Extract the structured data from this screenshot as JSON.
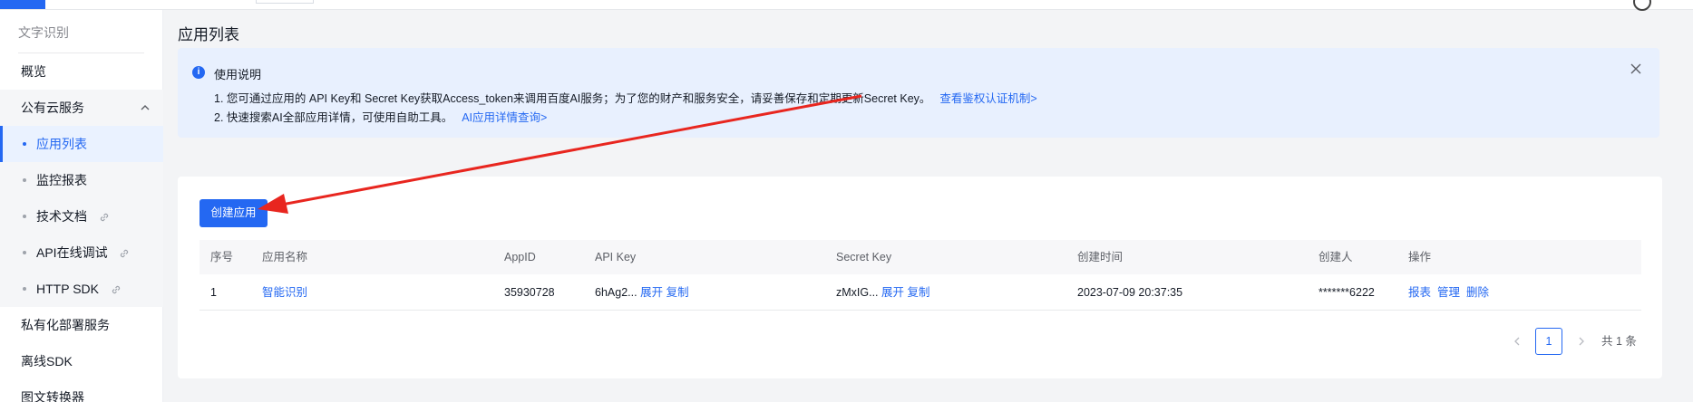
{
  "sidebar": {
    "title": "文字识别",
    "items": [
      {
        "label": "概览"
      },
      {
        "label": "公有云服务"
      },
      {
        "label": "应用列表"
      },
      {
        "label": "监控报表"
      },
      {
        "label": "技术文档"
      },
      {
        "label": "API在线调试"
      },
      {
        "label": "HTTP SDK"
      },
      {
        "label": "私有化部署服务"
      },
      {
        "label": "离线SDK"
      },
      {
        "label": "图文转换器"
      }
    ]
  },
  "main": {
    "title": "应用列表",
    "notice": {
      "title": "使用说明",
      "line1": "1. 您可通过应用的 API Key和 Secret Key获取Access_token来调用百度AI服务；为了您的财产和服务安全，请妥善保存和定期更新Secret Key。",
      "line1_link": "查看鉴权认证机制>",
      "line2": "2. 快速搜索AI全部应用详情，可使用自助工具。",
      "line2_link": "AI应用详情查询>"
    },
    "create_button": "创建应用",
    "table": {
      "headers": [
        "序号",
        "应用名称",
        "AppID",
        "API Key",
        "Secret Key",
        "创建时间",
        "创建人",
        "操作"
      ],
      "rows": [
        {
          "index": "1",
          "name": "智能识别",
          "appid": "35930728",
          "api_key": "6hAg2...",
          "secret_key": "zMxIG...",
          "expand": "展开",
          "copy": "复制",
          "created": "2023-07-09 20:37:35",
          "creator": "*******6222",
          "actions": [
            "报表",
            "管理",
            "删除"
          ]
        }
      ]
    },
    "pagination": {
      "current": "1",
      "total": "共 1 条"
    }
  },
  "colors": {
    "accent": "#2468f2",
    "notice_bg": "#e8f0fe",
    "annotation_arrow": "#e8261f"
  }
}
